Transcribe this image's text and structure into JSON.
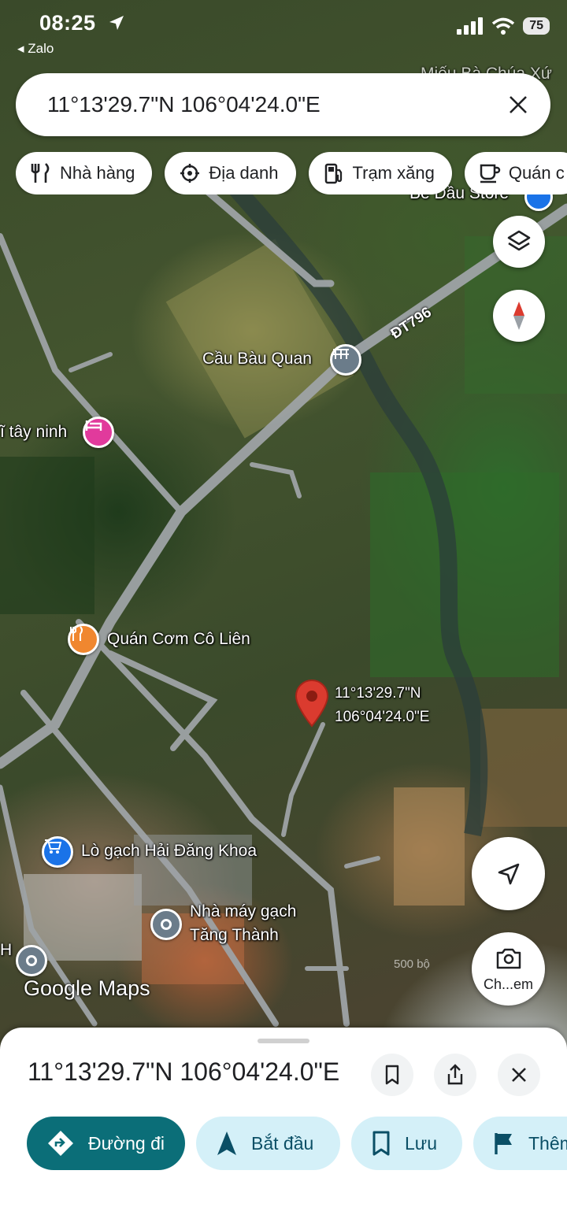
{
  "status_bar": {
    "time": "08:25",
    "back_app": "Zalo",
    "battery": "75"
  },
  "search": {
    "query": "11°13'29.7\"N 106°04'24.0\"E"
  },
  "chips": [
    {
      "label": "Nhà hàng",
      "icon": "restaurant-icon"
    },
    {
      "label": "Địa danh",
      "icon": "landmark-icon"
    },
    {
      "label": "Trạm xăng",
      "icon": "gas-station-icon"
    },
    {
      "label": "Quán c",
      "icon": "cafe-icon"
    }
  ],
  "map": {
    "labels": {
      "top_right": "Miếu Bà Chúa Xứ",
      "store": "Bé Dầu Store",
      "bridge": "Cầu Bàu Quan",
      "road": "ĐT796",
      "hotel": "ĩ tây ninh",
      "restaurant": "Quán Cơm Cô Liên",
      "pin_lat": "11°13'29.7\"N",
      "pin_lng": "106°04'24.0\"E",
      "shop": "Lò gạch Hải Đăng Khoa",
      "factory_line1": "Nhà máy gạch",
      "factory_line2": "Tăng Thành",
      "left_edge": "H"
    },
    "brand": {
      "google": "Google",
      "maps": "Maps"
    },
    "scale": "500 bộ",
    "lens_label": "Ch...em",
    "pin_color": "#db3b2f"
  },
  "sheet": {
    "title": "11°13'29.7\"N 106°04'24.0\"E",
    "actions": [
      {
        "label": "Đường đi",
        "icon": "directions-icon"
      },
      {
        "label": "Bắt đầu",
        "icon": "navigation-icon"
      },
      {
        "label": "Lưu",
        "icon": "bookmark-icon"
      },
      {
        "label": "Thêm",
        "icon": "flag-icon"
      }
    ]
  },
  "colors": {
    "accent": "#0b6e78",
    "chip_bg": "#d4f0f8",
    "pin": "#db3b2f"
  }
}
